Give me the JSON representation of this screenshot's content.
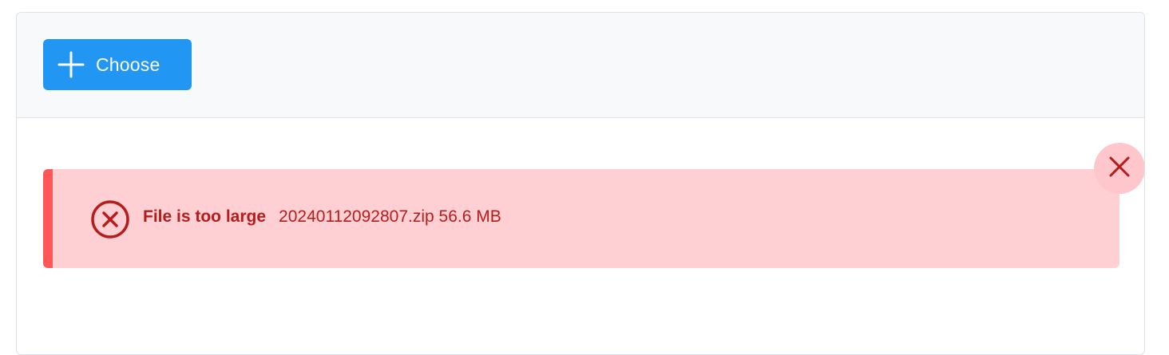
{
  "toolbar": {
    "choose_label": "Choose",
    "choose_icon": "plus-icon"
  },
  "message": {
    "severity": "error",
    "icon": "times-circle-icon",
    "summary": "File is too large",
    "detail": "20240112092807.zip 56.6 MB",
    "close_icon": "close-icon"
  },
  "colors": {
    "accent": "#2196f3",
    "error_bg": "#ffd0d3",
    "error_text": "#b71c1c",
    "error_border": "#ff5757"
  }
}
